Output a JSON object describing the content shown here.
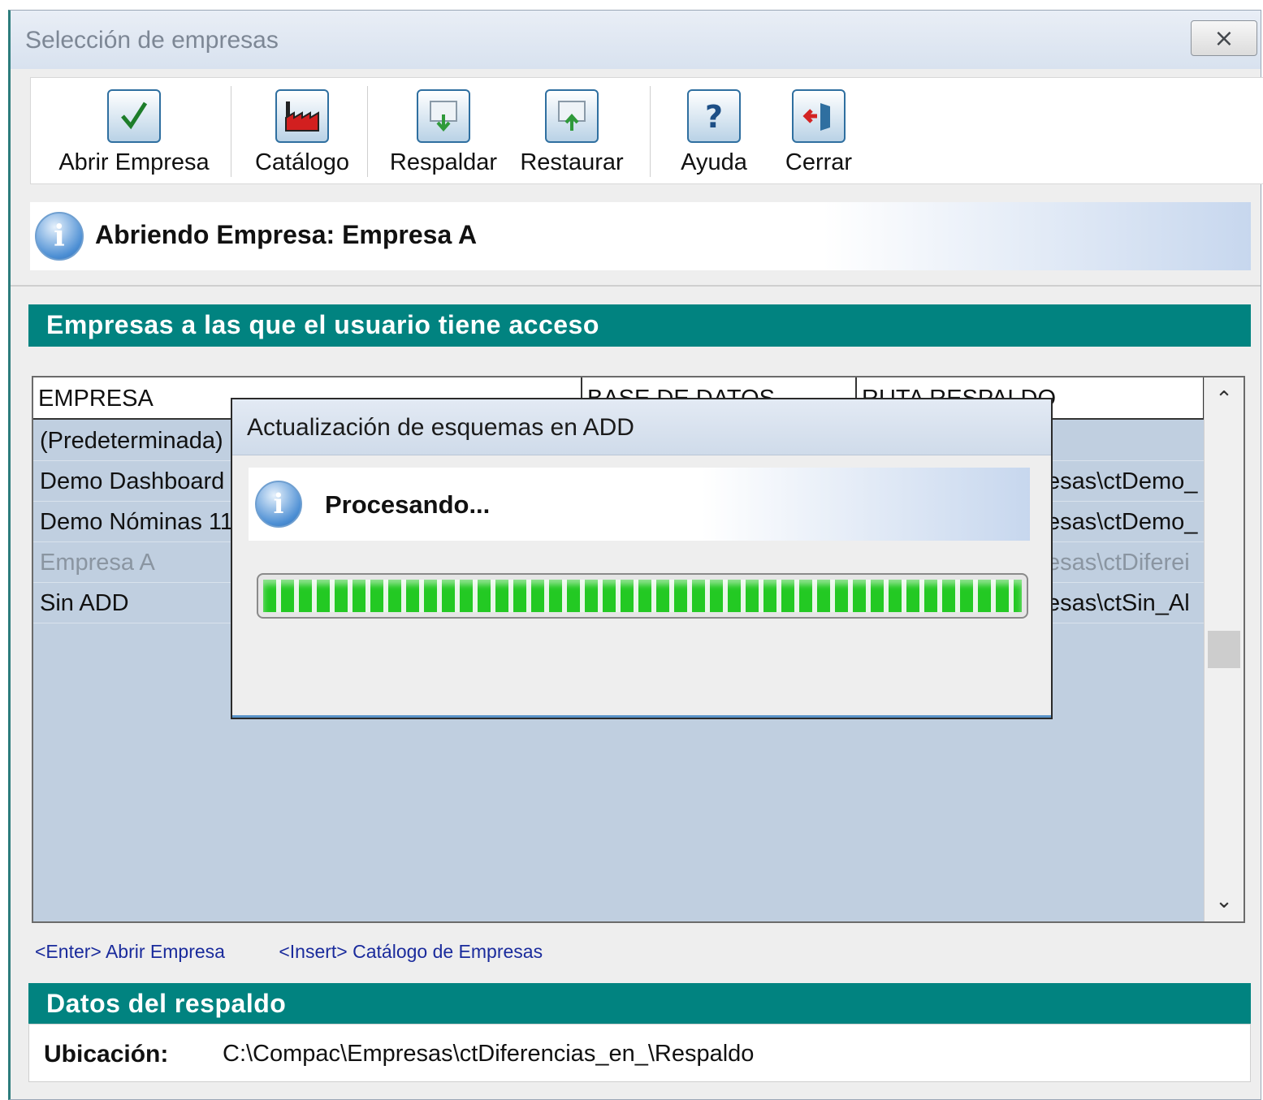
{
  "window": {
    "title": "Selección de empresas",
    "close_glyph": "⨯"
  },
  "toolbar": {
    "buttons": [
      {
        "label": "Abrir Empresa",
        "icon": "checkmark-icon"
      },
      {
        "label": "Catálogo",
        "icon": "factory-icon"
      },
      {
        "label": "Respaldar",
        "icon": "backup-icon"
      },
      {
        "label": "Restaurar",
        "icon": "restore-icon"
      },
      {
        "label": "Ayuda",
        "icon": "help-icon"
      },
      {
        "label": "Cerrar",
        "icon": "exit-icon"
      }
    ]
  },
  "status": {
    "icon": "info-icon",
    "message": "Abriendo Empresa: Empresa A"
  },
  "companies": {
    "header": "Empresas a las que el usuario tiene acceso",
    "columns": [
      "EMPRESA",
      "BASE DE DATOS",
      "RUTA RESPALDO"
    ],
    "rows": [
      {
        "empresa": "(Predeterminada)",
        "ruta": ""
      },
      {
        "empresa": "Demo Dashboard",
        "ruta": "esas\\ctDemo_"
      },
      {
        "empresa": "Demo Nóminas 11",
        "ruta": "esas\\ctDemo_"
      },
      {
        "empresa": "Empresa A",
        "ruta": "esas\\ctDiferei"
      },
      {
        "empresa": "Sin ADD",
        "ruta": "esas\\ctSin_Al"
      }
    ]
  },
  "shortcuts": {
    "enter": "<Enter> Abrir Empresa",
    "insert": "<Insert> Catálogo de Empresas"
  },
  "backup": {
    "header": "Datos del respaldo",
    "label": "Ubicación:",
    "value": "C:\\Compac\\Empresas\\ctDiferencias_en_\\Respaldo"
  },
  "modal": {
    "title": "Actualización de esquemas en ADD",
    "message": "Procesando...",
    "progress": 1.0
  },
  "colors": {
    "teal": "#018380",
    "grid_bg": "#c0cfe0",
    "progress_green": "#23c923",
    "link_blue": "#1a2b9c"
  }
}
